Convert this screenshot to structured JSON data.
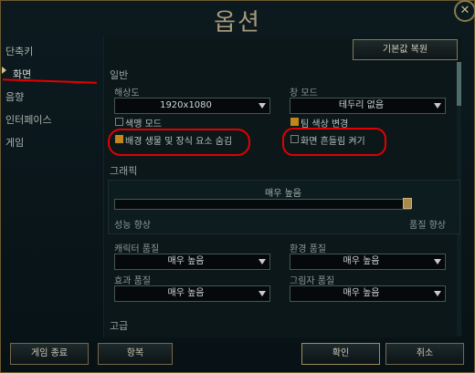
{
  "window": {
    "title": "옵션",
    "close_glyph": "✕"
  },
  "sidebar": {
    "items": [
      {
        "label": "단축키"
      },
      {
        "label": "화면"
      },
      {
        "label": "음향"
      },
      {
        "label": "인터페이스"
      },
      {
        "label": "게임"
      }
    ],
    "active": "화면"
  },
  "header": {
    "reset_button": "기본값 복원"
  },
  "general": {
    "heading": "일반",
    "resolution": {
      "label": "해상도",
      "value": "1920x1080"
    },
    "window_mode": {
      "label": "창 모드",
      "value": "테두리 없음"
    },
    "colorblind": {
      "label": "색맹 모드",
      "checked": false
    },
    "team_colors": {
      "label": "팀 색상 변경",
      "checked": true
    },
    "hide_eye_candy": {
      "label": "배경 생물 및 장식 요소 숨김",
      "checked": true
    },
    "screen_shake": {
      "label": "화면 흔들림 켜기",
      "checked": false
    }
  },
  "graphics": {
    "heading": "그래픽",
    "quality_label": "매우 높음",
    "left_label": "성능 향상",
    "right_label": "품질 향상",
    "slider_value": 1.0,
    "character_quality": {
      "label": "캐릭터 품질",
      "value": "매우 높음"
    },
    "environment_quality": {
      "label": "환경 품질",
      "value": "매우 높음"
    },
    "effects_quality": {
      "label": "효과 품질",
      "value": "매우 높음"
    },
    "shadow_quality": {
      "label": "그림자 품질",
      "value": "매우 높음"
    }
  },
  "advanced": {
    "heading": "고급"
  },
  "footer": {
    "quit": "게임 종료",
    "surrender": "항복",
    "ok": "확인",
    "cancel": "취소"
  },
  "colors": {
    "accent": "#c2861a",
    "annotation": "#e30000",
    "border_gold": "#86775a"
  }
}
